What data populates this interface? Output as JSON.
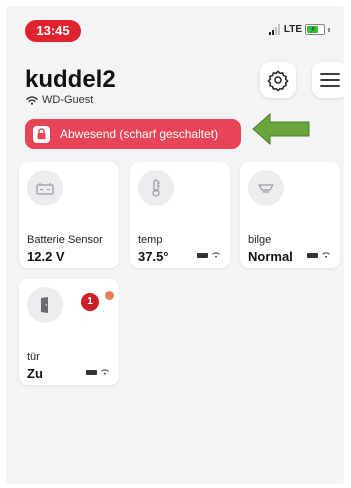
{
  "status_bar": {
    "time": "13:45",
    "network_type": "LTE"
  },
  "header": {
    "title": "kuddel2",
    "network_name": "WD-Guest"
  },
  "alarm": {
    "label": "Abwesend (scharf geschaltet)",
    "color": "#e84457"
  },
  "devices": [
    {
      "name": "Batterie Sensor",
      "value": "12.2 V",
      "icon": "battery-sensor-icon"
    },
    {
      "name": "temp",
      "value": "37.5°",
      "icon": "thermometer-icon"
    },
    {
      "name": "bilge",
      "value": "Normal",
      "icon": "bilge-sensor-icon"
    },
    {
      "name": "tür",
      "value": "Zu",
      "icon": "door-icon",
      "badge": "1"
    }
  ],
  "colors": {
    "accent": "#e0242f",
    "annotation_arrow": "#6aa63c",
    "background": "#f4f4f6"
  }
}
